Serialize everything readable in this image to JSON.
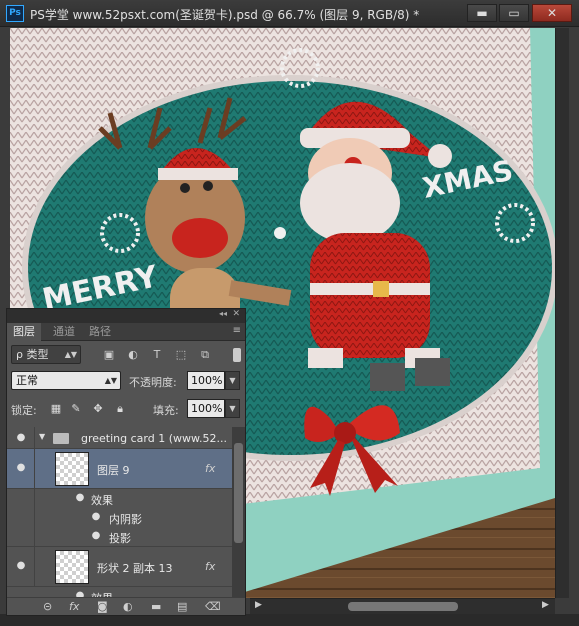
{
  "window": {
    "app_badge": "Ps",
    "title": "PS学堂 www.52psxt.com(圣诞贺卡).psd @ 66.7% (图层 9, RGB/8) *",
    "minimize": "▬",
    "maximize": "▭",
    "close": "✕"
  },
  "canvas": {
    "text_merry": "MERRY",
    "text_xmas": "XMAS",
    "colors": {
      "wood": "#6b4a2e",
      "knit_white": "#ece3e0",
      "knit_teal": "#1f7a72",
      "mint": "#8fd1c1",
      "red": "#c8241e"
    }
  },
  "panel": {
    "collapse": "◂◂",
    "close": "✕",
    "tabs": [
      "图层",
      "通道",
      "路径"
    ],
    "menu": "≡",
    "filter": {
      "kind_label": "ρ 类型",
      "icons": [
        "image-filter-icon",
        "adjustment-filter-icon",
        "type-filter-icon",
        "shape-filter-icon",
        "smart-object-filter-icon"
      ]
    },
    "blend_mode": "正常",
    "opacity_label": "不透明度:",
    "opacity_value": "100%",
    "lock_label": "锁定:",
    "fill_label": "填充:",
    "fill_value": "100%",
    "layers": {
      "group_name": "greeting card 1 (www.52...",
      "layer9_name": "图层 9",
      "effects_label": "效果",
      "inner_shadow": "内阴影",
      "drop_shadow": "投影",
      "shape_layer_name": "形状 2 副本 13",
      "shape_effects_partial": "效果",
      "fx": "fx"
    },
    "footer_icons": [
      "link-layers-icon",
      "fx-icon",
      "mask-icon",
      "adjustment-icon",
      "new-group-icon",
      "new-layer-icon",
      "delete-icon"
    ]
  }
}
